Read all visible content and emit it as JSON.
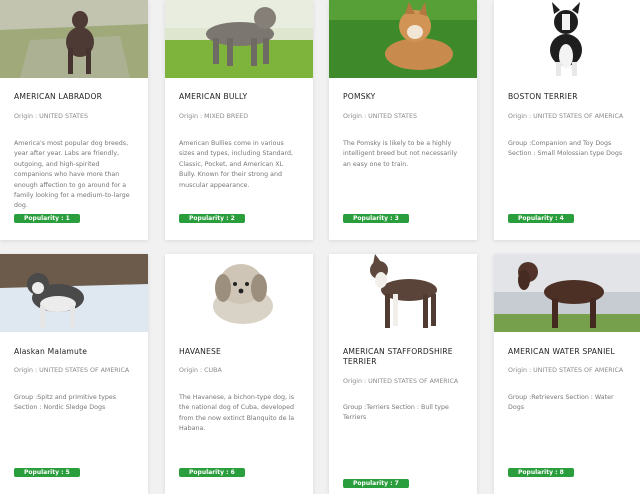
{
  "cards": [
    {
      "name": "AMERICAN LABRADOR",
      "origin": "Origin : UNITED STATES",
      "description": "America's most popular dog breeds, year after year. Labs are friendly, outgoing, and high-spirited companions who have more than enough affection to go around for a family looking for a medium-to-large dog.",
      "popularity": "Popularity : 1"
    },
    {
      "name": "AMERICAN BULLY",
      "origin": "Origin : MIXED BREED",
      "description": "American Bullies come in various sizes and types, including Standard, Classic, Pocket, and American XL Bully. Known for their strong and muscular appearance.",
      "popularity": "Popularity : 2"
    },
    {
      "name": "POMSKY",
      "origin": "Origin : UNITED STATES",
      "description": "The Pomsky is likely to be a highly intelligent breed but not necessarily an easy one to train.",
      "popularity": "Popularity : 3"
    },
    {
      "name": "BOSTON TERRIER",
      "origin": "Origin : UNITED STATES OF AMERICA",
      "description": "Group :Companion and Toy Dogs Section : Small Molossian type Dogs",
      "popularity": "Popularity : 4"
    },
    {
      "name": "Alaskan Malamute",
      "origin": "Origin : UNITED STATES OF AMERICA",
      "description": "Group :Spitz and primitive types Section : Nordic Sledge Dogs",
      "popularity": "Popularity : 5"
    },
    {
      "name": "HAVANESE",
      "origin": "Origin : CUBA",
      "description": "The Havanese, a bichon-type dog, is the national dog of Cuba, developed from the now extinct Blanquito de la Habana.",
      "popularity": "Popularity : 6"
    },
    {
      "name": "AMERICAN STAFFORDSHIRE TERRIER",
      "origin": "Origin : UNITED STATES OF AMERICA",
      "description": "Group :Terriers Section : Bull type Terriers",
      "popularity": "Popularity : 7"
    },
    {
      "name": "AMERICAN WATER SPANIEL",
      "origin": "Origin : UNITED STATES OF AMERICA",
      "description": "Group :Retrievers Section : Water Dogs",
      "popularity": "Popularity : 8"
    }
  ],
  "colors": {
    "page_background": "#f1f1f1",
    "card_background": "#ffffff",
    "badge_green": "#2a9d3c"
  }
}
